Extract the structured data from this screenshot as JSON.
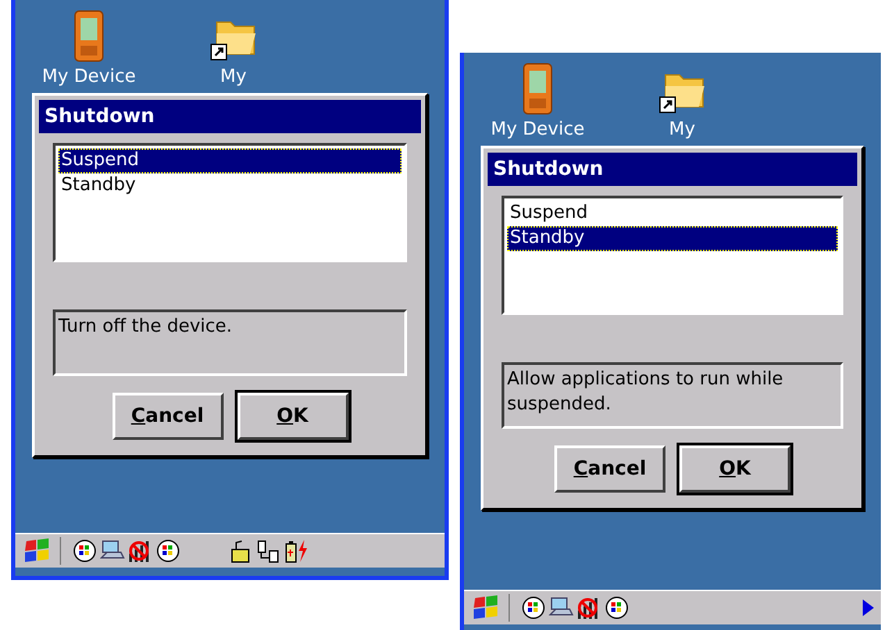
{
  "screens": [
    {
      "desktop_icons": [
        {
          "label": "My Device",
          "kind": "device"
        },
        {
          "label": "My",
          "kind": "folder-shortcut"
        }
      ],
      "dialog": {
        "title": "Shutdown",
        "options": [
          {
            "label": "Suspend",
            "selected": true
          },
          {
            "label": "Standby",
            "selected": false
          }
        ],
        "description": "Turn off the device.",
        "buttons": [
          {
            "label": "Cancel",
            "default": false,
            "mnemonic_underlined": true
          },
          {
            "label": "OK",
            "default": true,
            "mnemonic_underlined": true
          }
        ]
      },
      "taskbar": {
        "tray": [
          {
            "kind": "sync"
          },
          {
            "kind": "network"
          },
          {
            "kind": "no-signal"
          },
          {
            "kind": "sync"
          },
          {
            "kind": "gap"
          },
          {
            "kind": "lock"
          },
          {
            "kind": "connection"
          },
          {
            "kind": "battery"
          }
        ],
        "more_arrow": false
      }
    },
    {
      "desktop_icons": [
        {
          "label": "My Device",
          "kind": "device"
        },
        {
          "label": "My",
          "kind": "folder-shortcut"
        }
      ],
      "dialog": {
        "title": "Shutdown",
        "options": [
          {
            "label": "Suspend",
            "selected": false
          },
          {
            "label": "Standby",
            "selected": true
          }
        ],
        "description": "Allow applications to run while suspended.",
        "buttons": [
          {
            "label": "Cancel",
            "default": false,
            "mnemonic_underlined": true
          },
          {
            "label": "OK",
            "default": true,
            "mnemonic_underlined": true
          }
        ]
      },
      "taskbar": {
        "tray": [
          {
            "kind": "sync"
          },
          {
            "kind": "network"
          },
          {
            "kind": "no-signal"
          },
          {
            "kind": "sync"
          }
        ],
        "more_arrow": true
      }
    }
  ]
}
